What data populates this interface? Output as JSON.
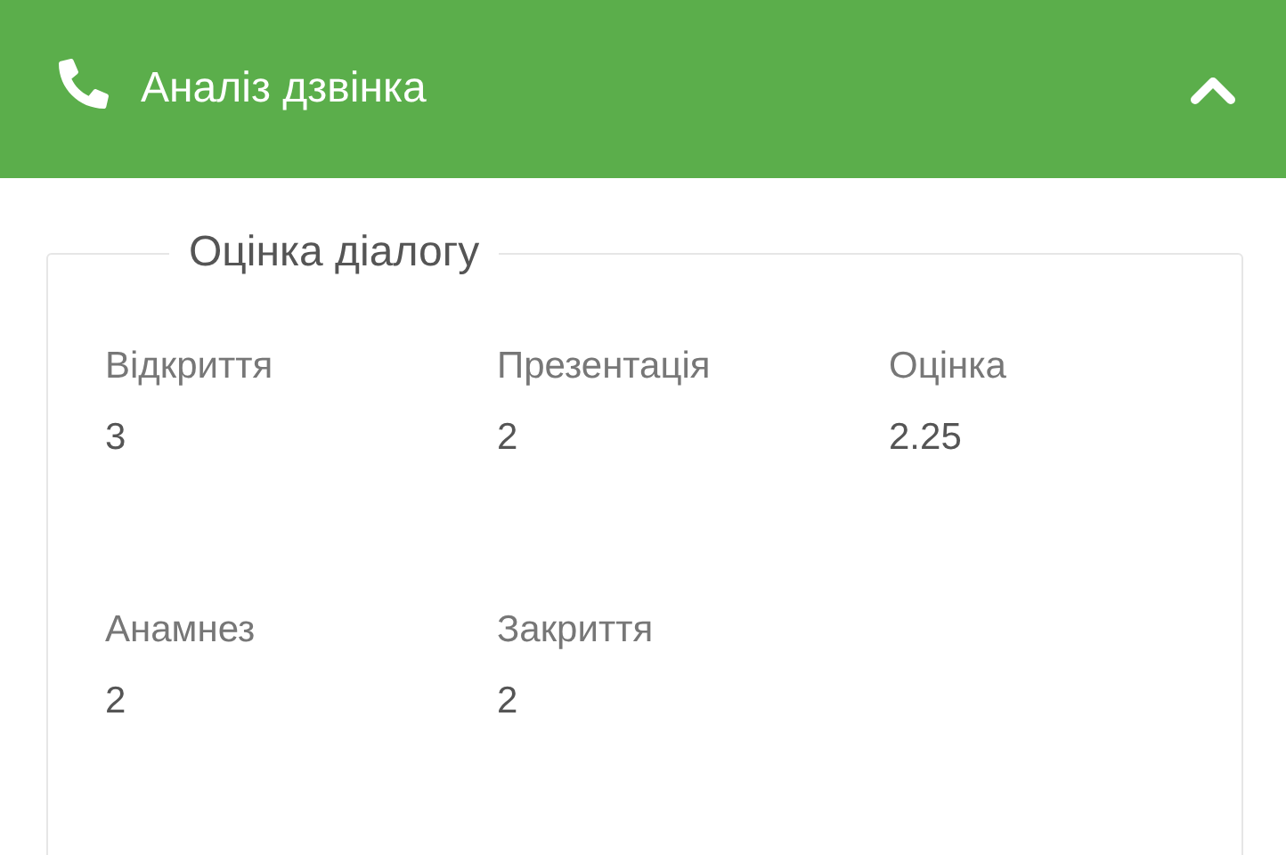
{
  "panel": {
    "title": "Аналіз дзвінка",
    "expanded": true
  },
  "section": {
    "legend": "Оцінка діалогу",
    "fields": [
      {
        "label": "Відкриття",
        "value": "3"
      },
      {
        "label": "Презентація",
        "value": "2"
      },
      {
        "label": "Оцінка",
        "value": "2.25"
      },
      {
        "label": "Анамнез",
        "value": "2"
      },
      {
        "label": "Закриття",
        "value": "2"
      }
    ]
  }
}
